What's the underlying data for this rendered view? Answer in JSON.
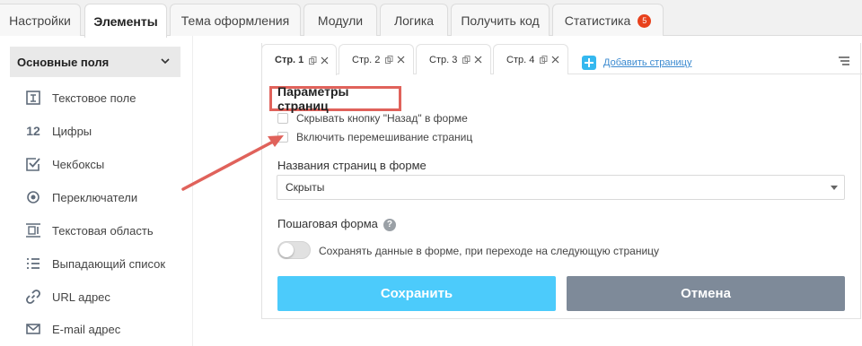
{
  "top_tabs": [
    {
      "label": "Настройки"
    },
    {
      "label": "Элементы"
    },
    {
      "label": "Тема оформления"
    },
    {
      "label": "Модули"
    },
    {
      "label": "Логика"
    },
    {
      "label": "Получить код"
    },
    {
      "label": "Статистика",
      "badge": "5"
    }
  ],
  "sidebar": {
    "header": "Основные поля",
    "items": [
      {
        "label": "Текстовое поле",
        "icon": "text-field-icon"
      },
      {
        "label": "Цифры",
        "icon_text": "12"
      },
      {
        "label": "Чекбоксы",
        "icon": "checkbox-icon"
      },
      {
        "label": "Переключатели",
        "icon": "radio-icon"
      },
      {
        "label": "Текстовая область",
        "icon": "textarea-icon"
      },
      {
        "label": "Выпадающий список",
        "icon": "list-icon"
      },
      {
        "label": "URL адрес",
        "icon": "link-icon"
      },
      {
        "label": "E-mail адрес",
        "icon": "mail-icon"
      }
    ]
  },
  "page_tabs": [
    {
      "label": "Стр. 1"
    },
    {
      "label": "Стр. 2"
    },
    {
      "label": "Стр. 3"
    },
    {
      "label": "Стр. 4"
    }
  ],
  "add_page_label": "Добавить страницу",
  "section_title": "Параметры страниц",
  "checkboxes": [
    {
      "label": "Скрывать кнопку \"Назад\" в форме",
      "checked": false
    },
    {
      "label": "Включить перемешивание страниц",
      "checked": false
    }
  ],
  "page_names": {
    "label": "Названия страниц в форме",
    "value": "Скрыты"
  },
  "stepwise": {
    "label": "Пошаговая форма",
    "help": "?",
    "toggle_label": "Сохранять данные в форме, при переходе на следующую страницу",
    "enabled": false
  },
  "buttons": {
    "save": "Сохранить",
    "cancel": "Отмена"
  },
  "colors": {
    "accent": "#4ccbfb",
    "cancel": "#7e8a99",
    "badge": "#e8411c",
    "highlight": "#e0625b"
  }
}
